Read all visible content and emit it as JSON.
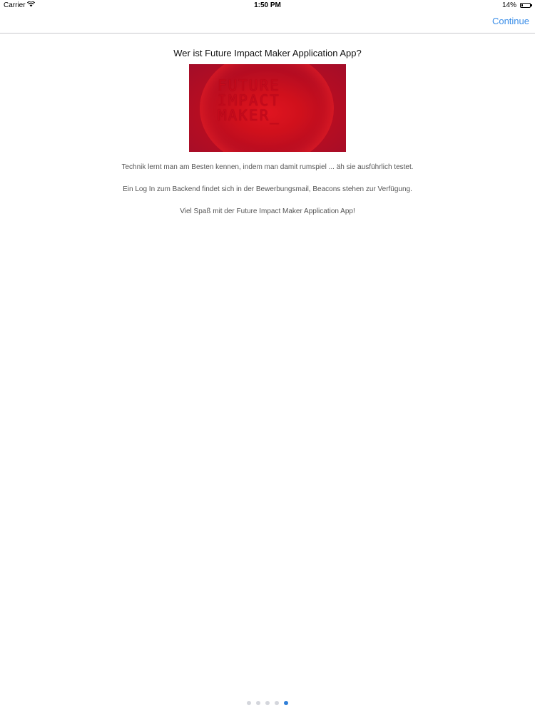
{
  "status_bar": {
    "carrier": "Carrier",
    "time": "1:50 PM",
    "battery": "14%",
    "battery_level": 0.14
  },
  "nav": {
    "continue_label": "Continue",
    "accent_color": "#3b8ee8"
  },
  "content": {
    "title": "Wer ist Future Impact Maker Application App?",
    "hero_logo_lines": [
      "FUTURE",
      "IMPACT",
      "MAKER_"
    ],
    "hero_color": "#c50a1c",
    "paragraph_1": "Technik lernt man am Besten kennen, indem man damit rumspiel ... äh sie ausführlich testet.",
    "paragraph_2": "Ein Log In zum Backend findet sich in der Bewerbungsmail, Beacons stehen zur Verfügung.",
    "paragraph_3": "Viel Spaß mit der Future Impact Maker Application App!"
  },
  "pager": {
    "total": 5,
    "current": 5
  }
}
